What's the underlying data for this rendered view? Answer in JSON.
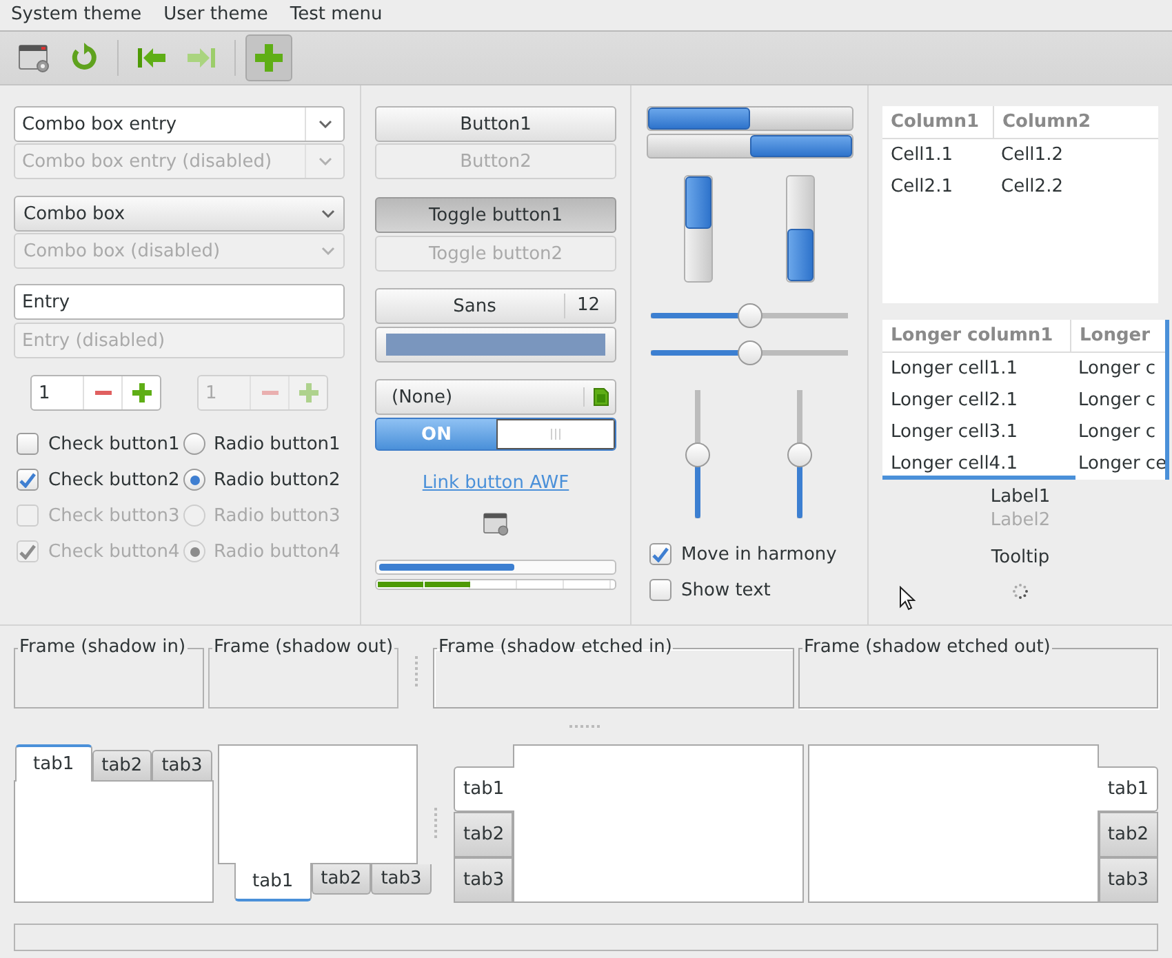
{
  "menu": [
    {
      "label": "System theme"
    },
    {
      "label": "User theme"
    },
    {
      "label": "Test menu"
    }
  ],
  "toolbar": [
    {
      "kind": "properties",
      "disabled": false,
      "pressed": false
    },
    {
      "kind": "refresh",
      "disabled": false,
      "pressed": false
    },
    {
      "kind": "separator"
    },
    {
      "kind": "first",
      "disabled": false,
      "pressed": false
    },
    {
      "kind": "last",
      "disabled": true,
      "pressed": false
    },
    {
      "kind": "separator"
    },
    {
      "kind": "add",
      "disabled": false,
      "pressed": true
    }
  ],
  "combo_box_entries": [
    {
      "value": "Combo box entry",
      "disabled": false
    },
    {
      "value": "Combo box entry (disabled)",
      "disabled": true
    }
  ],
  "combo_boxes": [
    {
      "value": "Combo box",
      "disabled": false
    },
    {
      "value": "Combo box (disabled)",
      "disabled": true
    }
  ],
  "entries": [
    {
      "value": "Entry",
      "disabled": false
    },
    {
      "value": "Entry (disabled)",
      "disabled": true
    }
  ],
  "spin_buttons": [
    {
      "value": "1",
      "disabled": false
    },
    {
      "value": "1",
      "disabled": true
    }
  ],
  "check_buttons": [
    {
      "label": "Check button1",
      "checked": false,
      "disabled": false
    },
    {
      "label": "Check button2",
      "checked": true,
      "disabled": false
    },
    {
      "label": "Check button3",
      "checked": false,
      "disabled": true
    },
    {
      "label": "Check button4",
      "checked": true,
      "disabled": true
    }
  ],
  "radio_buttons": [
    {
      "label": "Radio button1",
      "selected": false,
      "disabled": false
    },
    {
      "label": "Radio button2",
      "selected": true,
      "disabled": false
    },
    {
      "label": "Radio button3",
      "selected": false,
      "disabled": true
    },
    {
      "label": "Radio button4",
      "selected": true,
      "disabled": true
    }
  ],
  "buttons": [
    {
      "label": "Button1",
      "disabled": false
    },
    {
      "label": "Button2",
      "disabled": true
    }
  ],
  "toggle_buttons": [
    {
      "label": "Toggle button1",
      "pressed": true,
      "disabled": false
    },
    {
      "label": "Toggle button2",
      "pressed": false,
      "disabled": true
    }
  ],
  "font_button": {
    "family": "Sans",
    "size": "12"
  },
  "color_button": {
    "color": "#7a96be"
  },
  "file_chooser_button": {
    "label": "(None)"
  },
  "switch": {
    "label": "ON",
    "on": true
  },
  "link_button": {
    "label": "Link button AWF"
  },
  "progress_bars": [
    {
      "kind": "continuous",
      "level": 0.58
    },
    {
      "kind": "blocks",
      "level": 0.4
    }
  ],
  "progress_bars_horizontal": [
    {
      "level": 0.5,
      "inverted": false
    },
    {
      "level": 0.5,
      "inverted": true
    }
  ],
  "progress_bars_vertical": [
    {
      "level": 0.5,
      "inverted": false
    },
    {
      "level": 0.5,
      "inverted": true
    }
  ],
  "scales_horizontal": [
    {
      "level": 0.5
    },
    {
      "level": 0.5
    }
  ],
  "scales_vertical": [
    {
      "level": 0.5
    },
    {
      "level": 0.5
    }
  ],
  "harmony_checks": [
    {
      "label": "Move in harmony",
      "checked": true
    },
    {
      "label": "Show text",
      "checked": false
    }
  ],
  "tree_views": [
    {
      "columns": [
        "Column1",
        "Column2"
      ],
      "rows": [
        [
          "Cell1.1",
          "Cell1.2"
        ],
        [
          "Cell2.1",
          "Cell2.2"
        ]
      ]
    },
    {
      "columns": [
        "Longer column1",
        "Longer"
      ],
      "rows": [
        [
          "Longer cell1.1",
          "Longer c"
        ],
        [
          "Longer cell2.1",
          "Longer c"
        ],
        [
          "Longer cell3.1",
          "Longer c"
        ],
        [
          "Longer cell4.1",
          "Longer ce"
        ]
      ]
    }
  ],
  "labels": [
    {
      "text": "Label1",
      "disabled": false
    },
    {
      "text": "Label2",
      "disabled": true
    }
  ],
  "tooltip_label": {
    "text": "Tooltip"
  },
  "frames": [
    {
      "label": "Frame (shadow in)",
      "kind": "in"
    },
    {
      "label": "Frame (shadow out)",
      "kind": "out"
    },
    {
      "label": "Frame (shadow etched in)",
      "kind": "etched_in"
    },
    {
      "label": "Frame (shadow etched out)",
      "kind": "etched_out"
    }
  ],
  "notebooks": [
    {
      "kind": "top",
      "tabs": [
        {
          "label": "tab1",
          "selected": true
        },
        {
          "label": "tab2",
          "selected": false
        },
        {
          "label": "tab3",
          "selected": false
        }
      ]
    },
    {
      "kind": "bottom",
      "tabs": [
        {
          "label": "tab1",
          "selected": true
        },
        {
          "label": "tab2",
          "selected": false
        },
        {
          "label": "tab3",
          "selected": false
        }
      ]
    },
    {
      "kind": "left",
      "tabs": [
        {
          "label": "tab1",
          "selected": true
        },
        {
          "label": "tab2",
          "selected": false
        },
        {
          "label": "tab3",
          "selected": false
        }
      ]
    },
    {
      "kind": "right",
      "tabs": [
        {
          "label": "tab1",
          "selected": true
        },
        {
          "label": "tab2",
          "selected": false
        },
        {
          "label": "tab3",
          "selected": false
        }
      ]
    }
  ]
}
